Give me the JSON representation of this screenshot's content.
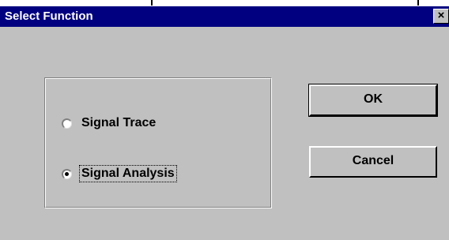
{
  "window": {
    "title": "Select Function",
    "close_glyph": "×"
  },
  "options": [
    {
      "label": "Signal Trace",
      "selected": false
    },
    {
      "label": "Signal Analysis",
      "selected": true
    }
  ],
  "buttons": {
    "ok_label": "OK",
    "cancel_label": "Cancel"
  },
  "icons": {
    "close": "close-icon",
    "radio": "radio-button-icon"
  },
  "colors": {
    "titlebar": "#000080",
    "title_text": "#ffffff",
    "dialog_face": "#c0c0c0"
  }
}
